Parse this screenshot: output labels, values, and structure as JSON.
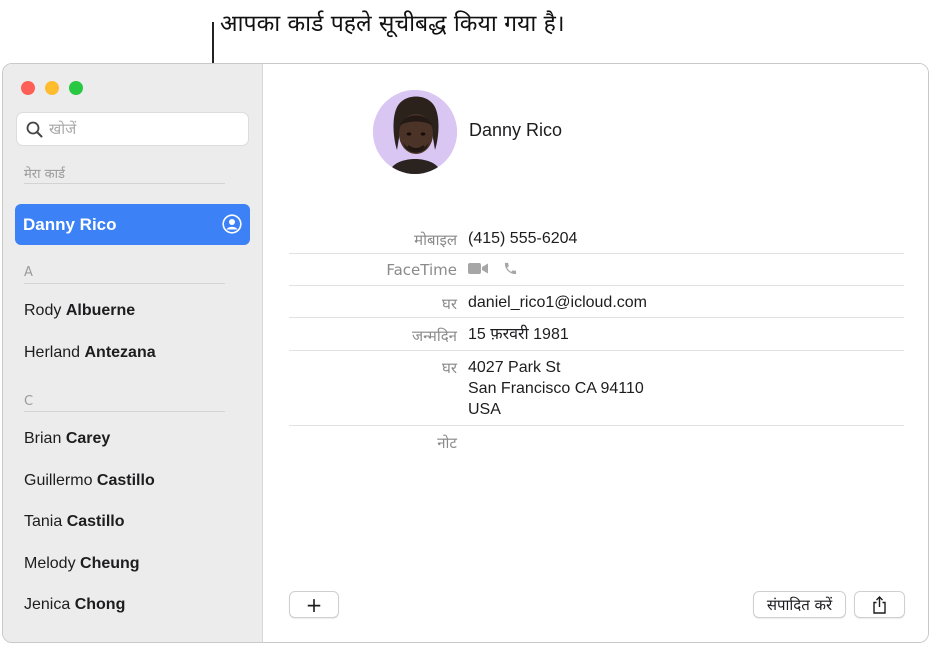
{
  "callout": {
    "text": "आपका कार्ड पहले सूचीबद्ध किया गया है।"
  },
  "sidebar": {
    "search_placeholder": "खोजें",
    "my_card_section": "मेरा कार्ड",
    "my_card_name": "Danny Rico",
    "sections": [
      {
        "letter": "A",
        "contacts": [
          {
            "first": "Rody",
            "last": "Albuerne"
          },
          {
            "first": "Herland",
            "last": "Antezana"
          }
        ]
      },
      {
        "letter": "C",
        "contacts": [
          {
            "first": "Brian",
            "last": "Carey"
          },
          {
            "first": "Guillermo",
            "last": "Castillo"
          },
          {
            "first": "Tania",
            "last": "Castillo"
          },
          {
            "first": "Melody",
            "last": "Cheung"
          },
          {
            "first": "Jenica",
            "last": "Chong"
          }
        ]
      }
    ]
  },
  "detail": {
    "name": "Danny Rico",
    "mobile_label": "मोबाइल",
    "mobile_value": "(415) 555-6204",
    "facetime_label": "FaceTime",
    "email_label": "घर",
    "email_value": "daniel_rico1@icloud.com",
    "birthday_label": "जन्मदिन",
    "birthday_value": "15 फ़रवरी 1981",
    "address_label": "घर",
    "address_lines": [
      "4027 Park St",
      "San Francisco CA 94110",
      "USA"
    ],
    "note_label": "नोट"
  },
  "buttons": {
    "add": "+",
    "edit": "संपादित करें"
  },
  "colors": {
    "selection": "#3c82f6",
    "close": "#fe5f57",
    "minimize": "#febc2e",
    "maximize": "#28c840",
    "avatar_bg": "#d9c6f2"
  },
  "icons": {
    "search": "magnifier",
    "my_card": "person-circle",
    "facetime_video": "video-camera",
    "facetime_audio": "phone",
    "share": "square-arrow-up"
  }
}
